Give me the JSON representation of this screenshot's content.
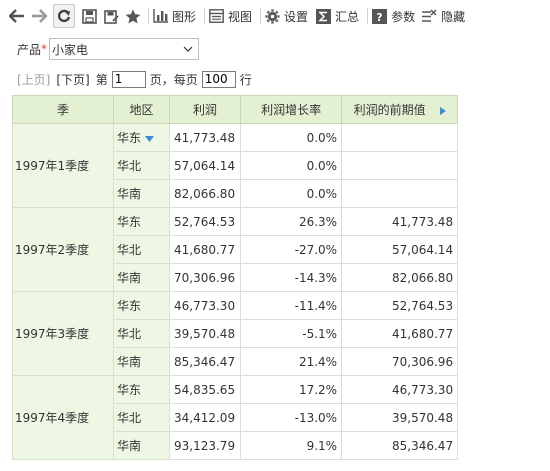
{
  "toolbar": {
    "chart_label": "图形",
    "view_label": "视图",
    "settings_label": "设置",
    "summary_label": "汇总",
    "params_label": "参数",
    "hide_label": "隐藏"
  },
  "filter": {
    "label": "产品",
    "required_mark": "*",
    "value": "小家电"
  },
  "pager": {
    "prev": "[上页]",
    "next": "[下页]",
    "page_prefix": "第",
    "page_value": "1",
    "page_suffix": "页，每页",
    "per_page_value": "100",
    "per_page_suffix": "行"
  },
  "table": {
    "headers": {
      "season": "季",
      "region": "地区",
      "profit": "利润",
      "growth": "利润增长率",
      "previous": "利润的前期值"
    },
    "groups": [
      {
        "quarter": "1997年1季度",
        "rows": [
          {
            "region": "华东",
            "profit": "41,773.48",
            "growth": "0.0%",
            "previous": ""
          },
          {
            "region": "华北",
            "profit": "57,064.14",
            "growth": "0.0%",
            "previous": ""
          },
          {
            "region": "华南",
            "profit": "82,066.80",
            "growth": "0.0%",
            "previous": ""
          }
        ]
      },
      {
        "quarter": "1997年2季度",
        "rows": [
          {
            "region": "华东",
            "profit": "52,764.53",
            "growth": "26.3%",
            "previous": "41,773.48"
          },
          {
            "region": "华北",
            "profit": "41,680.77",
            "growth": "-27.0%",
            "previous": "57,064.14"
          },
          {
            "region": "华南",
            "profit": "70,306.96",
            "growth": "-14.3%",
            "previous": "82,066.80"
          }
        ]
      },
      {
        "quarter": "1997年3季度",
        "rows": [
          {
            "region": "华东",
            "profit": "46,773.30",
            "growth": "-11.4%",
            "previous": "52,764.53"
          },
          {
            "region": "华北",
            "profit": "39,570.48",
            "growth": "-5.1%",
            "previous": "41,680.77"
          },
          {
            "region": "华南",
            "profit": "85,346.47",
            "growth": "21.4%",
            "previous": "70,306.96"
          }
        ]
      },
      {
        "quarter": "1997年4季度",
        "rows": [
          {
            "region": "华东",
            "profit": "54,835.65",
            "growth": "17.2%",
            "previous": "46,773.30"
          },
          {
            "region": "华北",
            "profit": "34,412.09",
            "growth": "-13.0%",
            "previous": "39,570.48"
          },
          {
            "region": "华南",
            "profit": "93,123.79",
            "growth": "9.1%",
            "previous": "85,346.47"
          }
        ]
      }
    ]
  },
  "colors": {
    "header_bg": "#e3f0d2",
    "dim_bg": "#eef6e4",
    "accent": "#3c8ad8",
    "required": "#e43d3d"
  }
}
